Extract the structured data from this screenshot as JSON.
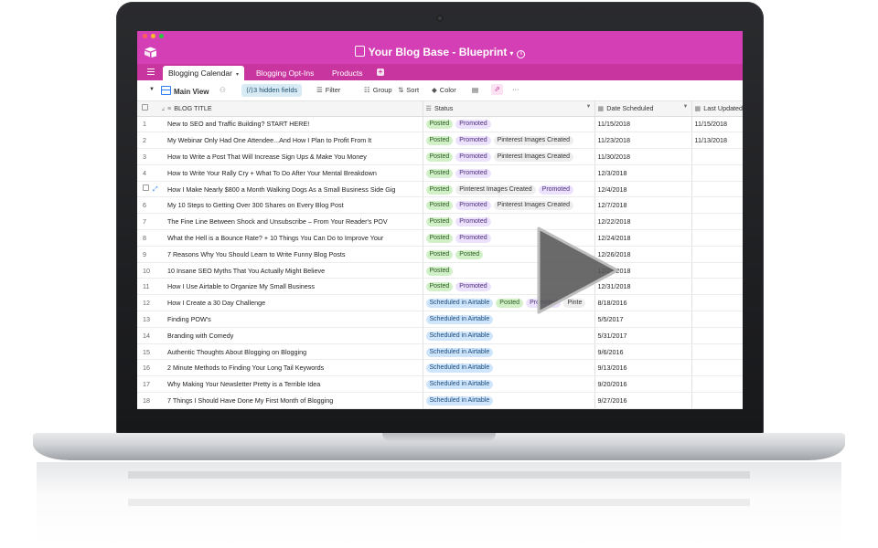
{
  "app": {
    "base_title": "Your Blog Base - Blueprint",
    "window_dots": [
      "#ff5f57",
      "#febc2e",
      "#28c840"
    ],
    "brand_color": "#d43fb6"
  },
  "tabs": [
    {
      "label": "Blogging Calendar",
      "active": true
    },
    {
      "label": "Blogging Opt-Ins",
      "active": false
    },
    {
      "label": "Products",
      "active": false
    }
  ],
  "toolbar": {
    "view_name": "Main View",
    "hidden_fields": "3 hidden fields",
    "filter": "Filter",
    "group": "Group",
    "sort": "Sort",
    "color": "Color",
    "more": "···"
  },
  "columns": {
    "title": "BLOG TITLE",
    "status": "Status",
    "date": "Date Scheduled",
    "updated": "Last Updated"
  },
  "rows": [
    {
      "n": "1",
      "title": "New to SEO and Traffic Building? START HERE!",
      "status": [
        "Posted",
        "Promoted"
      ],
      "date": "11/15/2018",
      "updated": "11/15/2018"
    },
    {
      "n": "2",
      "title": "My Webinar Only Had One Attendee...And How I Plan to Profit From It",
      "status": [
        "Posted",
        "Promoted",
        "Pinterest Images Created"
      ],
      "date": "11/23/2018",
      "updated": "11/13/2018"
    },
    {
      "n": "3",
      "title": "How to Write a Post That Will Increase Sign Ups & Make You Money",
      "status": [
        "Posted",
        "Promoted",
        "Pinterest Images Created"
      ],
      "date": "11/30/2018",
      "updated": ""
    },
    {
      "n": "4",
      "title": "How to Write Your Rally Cry + What To Do After Your Mental Breakdown",
      "status": [
        "Posted",
        "Promoted"
      ],
      "date": "12/3/2018",
      "updated": ""
    },
    {
      "n": "",
      "title": "How I Make Nearly $800 a Month Walking Dogs As a Small Business Side Gig",
      "status": [
        "Posted",
        "Pinterest Images Created",
        "Promoted"
      ],
      "date": "12/4/2018",
      "updated": ""
    },
    {
      "n": "6",
      "title": "My 10 Steps to Getting Over 300 Shares on Every Blog Post",
      "status": [
        "Posted",
        "Promoted",
        "Pinterest Images Created"
      ],
      "date": "12/7/2018",
      "updated": ""
    },
    {
      "n": "7",
      "title": "The Fine Line Between Shock and Unsubscribe – From Your Reader's POV",
      "status": [
        "Posted",
        "Promoted"
      ],
      "date": "12/22/2018",
      "updated": ""
    },
    {
      "n": "8",
      "title": "What the Hell is a Bounce Rate? + 10 Things You Can Do to Improve Your",
      "status": [
        "Posted",
        "Promoted"
      ],
      "date": "12/24/2018",
      "updated": ""
    },
    {
      "n": "9",
      "title": "7 Reasons Why You Should Learn to Write Funny Blog Posts",
      "status": [
        "Posted",
        "Posted"
      ],
      "date": "12/26/2018",
      "updated": ""
    },
    {
      "n": "10",
      "title": "10 Insane SEO Myths That You Actually Might Believe",
      "status": [
        "Posted"
      ],
      "date": "12/29/2018",
      "updated": ""
    },
    {
      "n": "11",
      "title": "How I Use Airtable to Organize My Small Business",
      "status": [
        "Posted",
        "Promoted"
      ],
      "date": "12/31/2018",
      "updated": ""
    },
    {
      "n": "12",
      "title": "How I Create a 30 Day Challenge",
      "status": [
        "Scheduled in Airtable",
        "Posted",
        "Promoted",
        "Pinte"
      ],
      "date": "8/18/2016",
      "updated": ""
    },
    {
      "n": "13",
      "title": "Finding POW's",
      "status": [
        "Scheduled in Airtable"
      ],
      "date": "5/5/2017",
      "updated": ""
    },
    {
      "n": "14",
      "title": "Branding with Comedy",
      "status": [
        "Scheduled in Airtable"
      ],
      "date": "5/31/2017",
      "updated": ""
    },
    {
      "n": "15",
      "title": "Authentic Thoughts About Blogging on Blogging",
      "status": [
        "Scheduled in Airtable"
      ],
      "date": "9/6/2016",
      "updated": ""
    },
    {
      "n": "16",
      "title": "2 Minute Methods to Finding Your Long Tail Keywords",
      "status": [
        "Scheduled in Airtable"
      ],
      "date": "9/13/2016",
      "updated": ""
    },
    {
      "n": "17",
      "title": "Why Making Your Newsletter Pretty is a Terrible Idea",
      "status": [
        "Scheduled in Airtable"
      ],
      "date": "9/20/2016",
      "updated": ""
    },
    {
      "n": "18",
      "title": "7 Things I Should Have Done My First Month of Blogging",
      "status": [
        "Scheduled in Airtable"
      ],
      "date": "9/27/2016",
      "updated": ""
    }
  ],
  "status_colors": {
    "Posted": "#d2f0c8",
    "Promoted": "#ede2fe",
    "Pinterest Images Created": "#eeeeee",
    "Scheduled in Airtable": "#cfe5fc"
  },
  "overlay": {
    "icon": "play-icon"
  }
}
